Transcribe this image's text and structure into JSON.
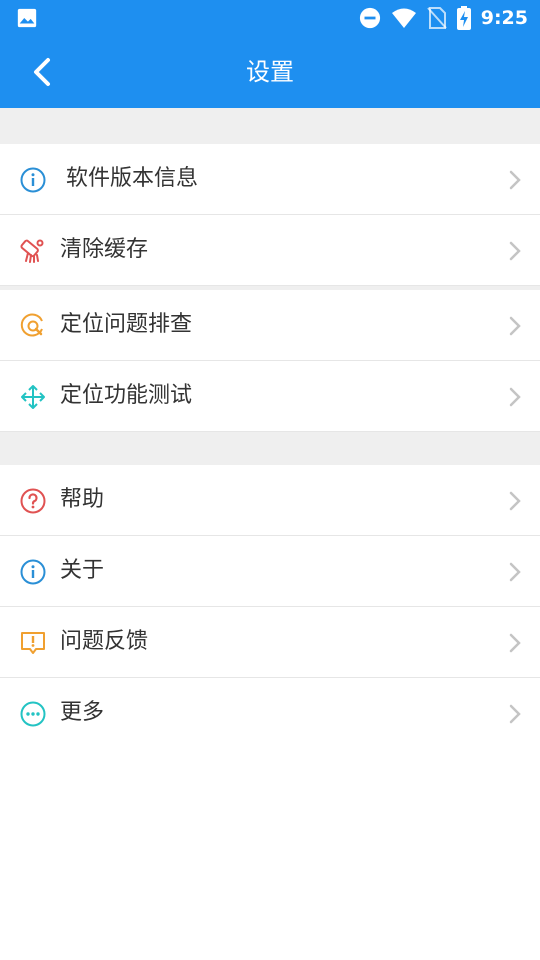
{
  "status_bar": {
    "time": "9:25",
    "icons": [
      "image-icon",
      "dnd-icon",
      "wifi-icon",
      "no-sim-icon",
      "battery-charging-icon"
    ]
  },
  "app_bar": {
    "title": "设置",
    "back_icon": "chevron-left-icon"
  },
  "colors": {
    "primary": "#1e8ff0",
    "divider": "#efefef",
    "info_blue": "#2a8fd6",
    "red": "#e05252",
    "orange": "#f0a030",
    "teal": "#23c3c3"
  },
  "sections": [
    {
      "items": [
        {
          "label": "软件版本信息",
          "icon": "info-icon"
        }
      ]
    },
    {
      "items": [
        {
          "label": "清除缓存",
          "icon": "broom-icon"
        }
      ]
    },
    {
      "items": [
        {
          "label": "定位问题排查",
          "icon": "at-location-icon"
        },
        {
          "label": "定位功能测试",
          "icon": "move-arrows-icon"
        }
      ]
    },
    {
      "items": [
        {
          "label": "帮助",
          "icon": "help-icon"
        },
        {
          "label": "关于",
          "icon": "info-icon"
        },
        {
          "label": "问题反馈",
          "icon": "feedback-icon"
        },
        {
          "label": "更多",
          "icon": "more-icon"
        }
      ]
    }
  ]
}
